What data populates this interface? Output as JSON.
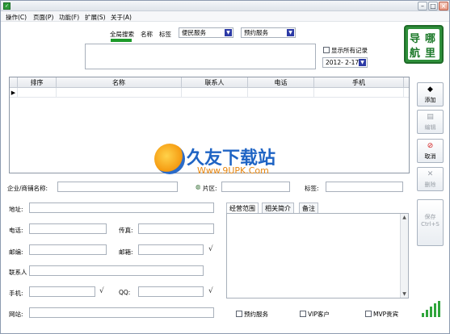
{
  "window": {
    "app_icon": "app-icon",
    "controls": [
      "minimize",
      "maximize",
      "close"
    ]
  },
  "menu": {
    "items": [
      "操作(C)",
      "页面(P)",
      "功能(F)",
      "扩展(S)",
      "关于(A)"
    ]
  },
  "search": {
    "tabs": [
      "全局搜索",
      "名称",
      "标签"
    ],
    "active_tab": "全局搜索",
    "category_select": "便民服务",
    "type_select": "预约服务",
    "show_all_label": "显示所有记录",
    "date_value": "2012- 2-17",
    "query_text": ""
  },
  "logo": {
    "chars": [
      "导",
      "哪",
      "航",
      "里"
    ]
  },
  "grid": {
    "columns": [
      "排序",
      "名称",
      "联系人",
      "电话",
      "手机"
    ],
    "rows": [
      {
        "indicator": "▶",
        "cells": [
          "",
          "",
          "",
          "",
          ""
        ]
      }
    ]
  },
  "side_buttons": [
    {
      "label": "添加",
      "icon": "add-icon",
      "enabled": true
    },
    {
      "label": "编辑",
      "icon": "edit-icon",
      "enabled": false
    },
    {
      "label": "取消",
      "icon": "cancel-icon",
      "enabled": true
    },
    {
      "label": "删除",
      "icon": "delete-icon",
      "enabled": false
    },
    {
      "label": "保存",
      "sub": "Ctrl+S",
      "icon": "save-icon",
      "enabled": false
    }
  ],
  "form": {
    "company_label": "企业/商铺名称:",
    "region_label": "片区:",
    "tag_label": "标签:",
    "address_label": "地址:",
    "phone_label": "电话:",
    "fax_label": "传真:",
    "zip_label": "邮编:",
    "email_label": "邮箱:",
    "contact_label": "联系人",
    "mobile_label": "手机:",
    "qq_label": "QQ:",
    "website_label": "网站:",
    "check_mark": "√"
  },
  "detail_tabs": [
    "经营范围",
    "相关简介",
    "备注"
  ],
  "detail_active_tab": "经营范围",
  "flags": [
    "预约服务",
    "VIP客户",
    "MVP贵宾"
  ],
  "watermark": {
    "title": "久友下载站",
    "url": "Www.9UPK.Com"
  },
  "colors": {
    "accent_green": "#1d9a2a",
    "logo_green": "#2e8f3a",
    "select_arrow": "#2c3aa6"
  }
}
